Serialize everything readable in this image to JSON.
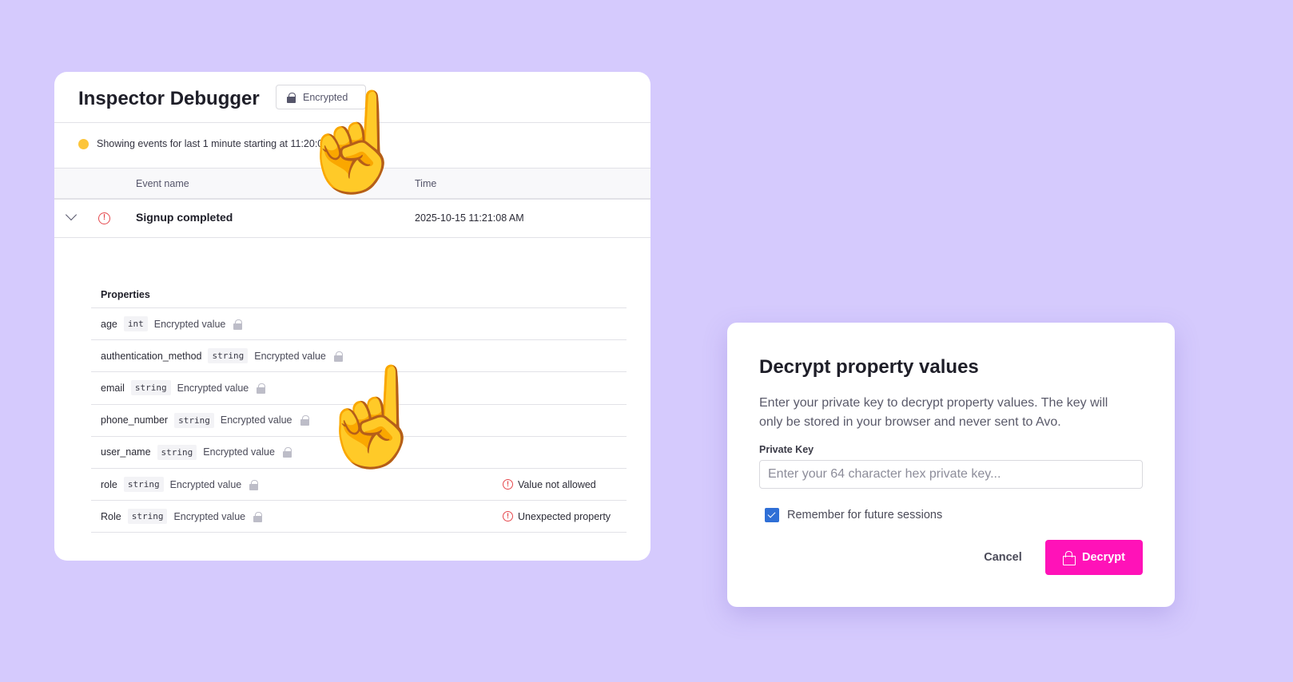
{
  "debugger": {
    "title": "Inspector Debugger",
    "badge": "Encrypted",
    "info": "Showing events for last 1 minute starting at 11:20:08 AM",
    "columns": [
      "Event name",
      "Time"
    ],
    "event": {
      "name": "Signup completed",
      "time": "2025-10-15 11:21:08 AM",
      "icon": "alert-circle-icon"
    },
    "properties_label": "Properties",
    "properties": [
      {
        "name": "age",
        "type": "int",
        "value": "Encrypted value",
        "error": ""
      },
      {
        "name": "authentication_method",
        "type": "string",
        "value": "Encrypted value",
        "error": ""
      },
      {
        "name": "email",
        "type": "string",
        "value": "Encrypted value",
        "error": ""
      },
      {
        "name": "phone_number",
        "type": "string",
        "value": "Encrypted value",
        "error": ""
      },
      {
        "name": "user_name",
        "type": "string",
        "value": "Encrypted value",
        "error": ""
      },
      {
        "name": "role",
        "type": "string",
        "value": "Encrypted value",
        "error": "Value not allowed"
      },
      {
        "name": "Role",
        "type": "string",
        "value": "Encrypted value",
        "error": "Unexpected property"
      }
    ]
  },
  "modal": {
    "title": "Decrypt property values",
    "description": "Enter your private key to decrypt property values. The key will only be stored in your browser and never sent to Avo.",
    "label": "Private Key",
    "placeholder": "Enter your 64 character hex private key...",
    "value": "",
    "remember_label": "Remember for future sessions",
    "remember_checked": true,
    "cancel": "Cancel",
    "decrypt": "Decrypt"
  },
  "colors": {
    "background": "#d5cafd",
    "accent": "#ff12b8",
    "checkbox": "#2f6fd6",
    "error": "#e5484d",
    "status_dot": "#fcc53a"
  }
}
